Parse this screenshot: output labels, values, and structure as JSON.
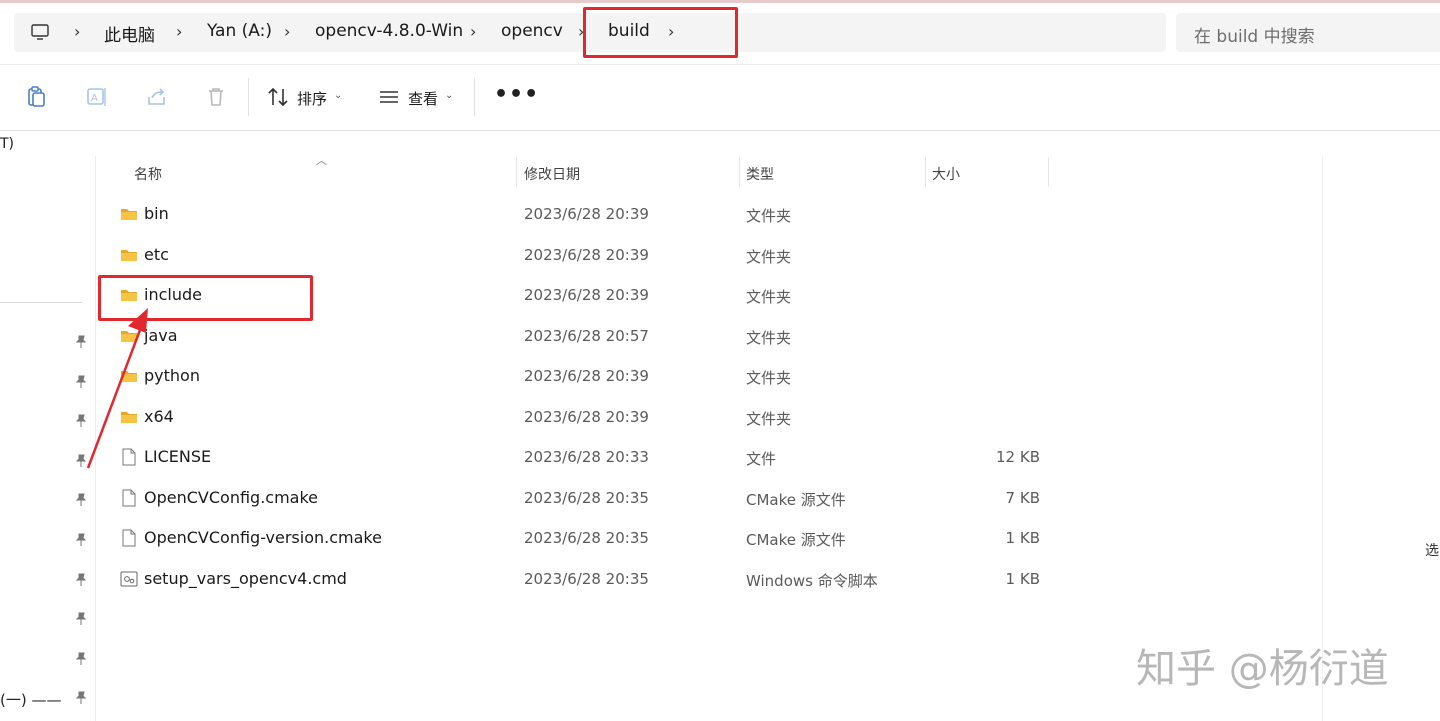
{
  "breadcrumb": {
    "items": [
      "此电脑",
      "Yan (A:)",
      "opencv-4.8.0-Win",
      "opencv",
      "build"
    ],
    "separator": ">"
  },
  "search": {
    "placeholder": "在 build 中搜索"
  },
  "toolbar": {
    "sort_label": "排序",
    "view_label": "查看",
    "more_label": "•••"
  },
  "left_partial_label": "T)",
  "columns": {
    "name": "名称",
    "date": "修改日期",
    "type": "类型",
    "size": "大小"
  },
  "files": [
    {
      "name": "bin",
      "date": "2023/6/28 20:39",
      "type": "文件夹",
      "size": "",
      "icon": "folder-icon"
    },
    {
      "name": "etc",
      "date": "2023/6/28 20:39",
      "type": "文件夹",
      "size": "",
      "icon": "folder-icon"
    },
    {
      "name": "include",
      "date": "2023/6/28 20:39",
      "type": "文件夹",
      "size": "",
      "icon": "folder-icon"
    },
    {
      "name": "java",
      "date": "2023/6/28 20:57",
      "type": "文件夹",
      "size": "",
      "icon": "folder-icon"
    },
    {
      "name": "python",
      "date": "2023/6/28 20:39",
      "type": "文件夹",
      "size": "",
      "icon": "folder-icon"
    },
    {
      "name": "x64",
      "date": "2023/6/28 20:39",
      "type": "文件夹",
      "size": "",
      "icon": "folder-icon"
    },
    {
      "name": "LICENSE",
      "date": "2023/6/28 20:33",
      "type": "文件",
      "size": "12 KB",
      "icon": "file-icon"
    },
    {
      "name": "OpenCVConfig.cmake",
      "date": "2023/6/28 20:35",
      "type": "CMake 源文件",
      "size": "7 KB",
      "icon": "file-icon"
    },
    {
      "name": "OpenCVConfig-version.cmake",
      "date": "2023/6/28 20:35",
      "type": "CMake 源文件",
      "size": "1 KB",
      "icon": "file-icon"
    },
    {
      "name": "setup_vars_opencv4.cmd",
      "date": "2023/6/28 20:35",
      "type": "Windows 命令脚本",
      "size": "1 KB",
      "icon": "script-file-icon"
    }
  ],
  "nav_bottom_text": "(一) ——",
  "right_edge_text": "选",
  "watermark": "知乎 @杨衍道",
  "colors": {
    "annotation": "#e0282e",
    "folder": "#f6c342",
    "folder_dark": "#e3a92a"
  }
}
